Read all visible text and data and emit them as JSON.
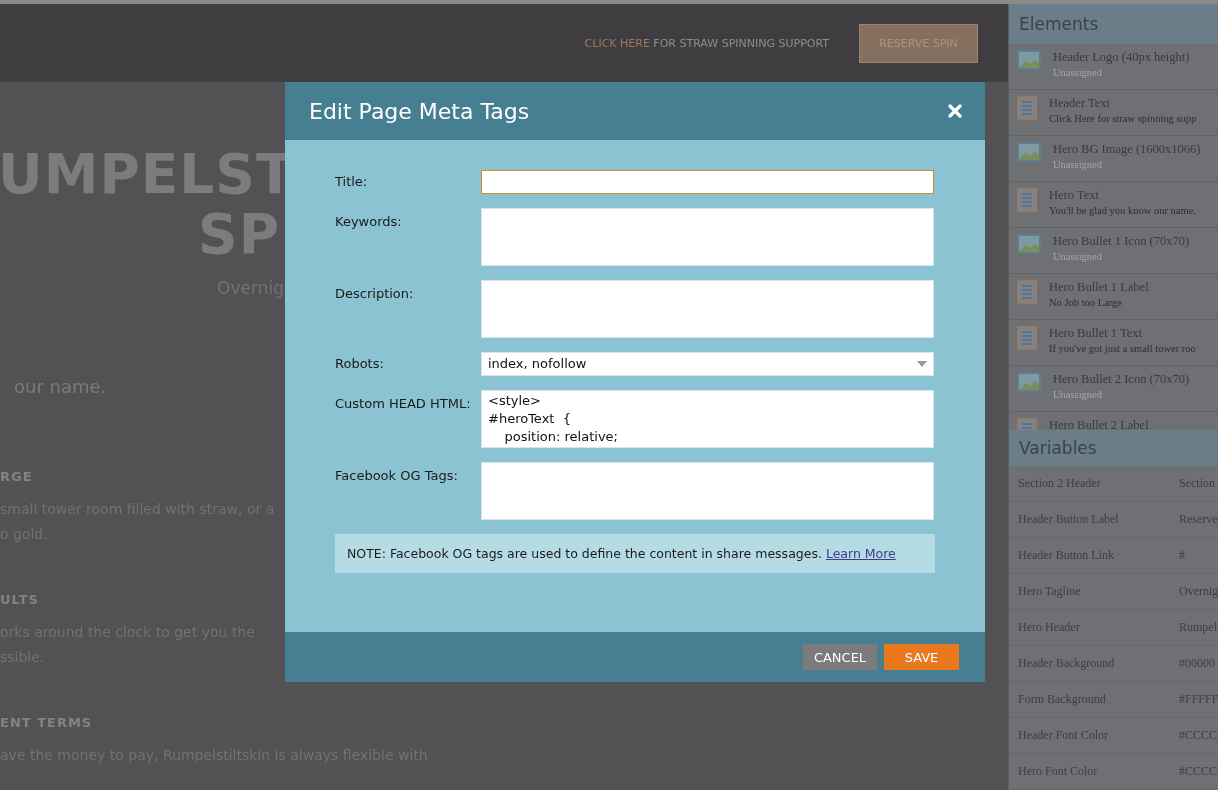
{
  "top_bar": {
    "link": "CLICK HERE",
    "text": " FOR STRAW SPINNING SUPPORT",
    "button": "RESERVE SPIN"
  },
  "hero": {
    "headline": [
      "UMPELST",
      "SP"
    ],
    "tagline": "Overnig",
    "text": "our name."
  },
  "sections": [
    {
      "heading": "RGE",
      "lines": [
        "small tower room filled with straw, or a",
        "o gold."
      ]
    },
    {
      "heading": "ULTS",
      "lines": [
        "orks around the clock to get you the",
        "ssible."
      ]
    },
    {
      "heading": "ENT TERMS",
      "lines": [
        "ave the money to pay, Rumpelstiltskin is always flexible with"
      ]
    }
  ],
  "modal": {
    "title": "Edit Page Meta Tags",
    "fields": [
      {
        "label": "Title:",
        "kind": "input",
        "focused": true
      },
      {
        "label": "Keywords:",
        "kind": "textarea",
        "focused": false
      },
      {
        "label": "Description:",
        "kind": "textarea",
        "focused": false
      },
      {
        "label": "Robots:",
        "kind": "select",
        "value": "index, nofollow",
        "focused": false
      },
      {
        "label": "Custom HEAD HTML:",
        "kind": "textarea",
        "value": "<style>\n#heroText  {\n    position: relative;",
        "focused": false
      },
      {
        "label": "Facebook OG Tags:",
        "kind": "textarea",
        "focused": false
      }
    ],
    "note": {
      "text": "NOTE:  Facebook OG tags are used to define the content in share messages.",
      "link": "Learn More"
    },
    "buttons": [
      {
        "label": "CANCEL",
        "kind": "secondary"
      },
      {
        "label": "SAVE",
        "kind": "primary"
      }
    ]
  },
  "elements": {
    "title": "Elements",
    "items": [
      {
        "kind": "image",
        "name": "Header Logo (40px height)",
        "detail": "Unassigned",
        "assigned": false
      },
      {
        "kind": "text",
        "name": "Header Text",
        "detail": "Click Here for straw spinning supp",
        "assigned": true
      },
      {
        "kind": "image",
        "name": "Hero BG Image (1600x1066)",
        "detail": "Unassigned",
        "assigned": false
      },
      {
        "kind": "text",
        "name": "Hero Text",
        "detail": "You'll be glad you know our name.",
        "assigned": true
      },
      {
        "kind": "image",
        "name": "Hero Bullet 1 Icon (70x70)",
        "detail": "Unassigned",
        "assigned": false
      },
      {
        "kind": "text",
        "name": "Hero Bullet 1 Label",
        "detail": "No Job too Large",
        "assigned": true
      },
      {
        "kind": "text",
        "name": "Hero Bullet 1 Text",
        "detail": "If you've got just a small tower roo",
        "assigned": true
      },
      {
        "kind": "image",
        "name": "Hero Bullet 2 Icon (70x70)",
        "detail": "Unassigned",
        "assigned": false
      },
      {
        "kind": "text",
        "name": "Hero Bullet 2 Label"
      }
    ]
  },
  "variables": {
    "title": "Variables",
    "rows": [
      {
        "name": "Section 2 Header",
        "value": "Section"
      },
      {
        "name": "Header Button Label",
        "value": "Reserve"
      },
      {
        "name": "Header Button Link",
        "value": "#"
      },
      {
        "name": "Hero Tagline",
        "value": "Overnig"
      },
      {
        "name": "Hero Header",
        "value": "Rumpel"
      },
      {
        "name": "Header Background",
        "value": "#00000"
      },
      {
        "name": "Form Background",
        "value": "#FFFFF"
      },
      {
        "name": "Header Font Color",
        "value": "#CCCC"
      },
      {
        "name": "Hero Font Color",
        "value": "#CCCC"
      }
    ]
  }
}
